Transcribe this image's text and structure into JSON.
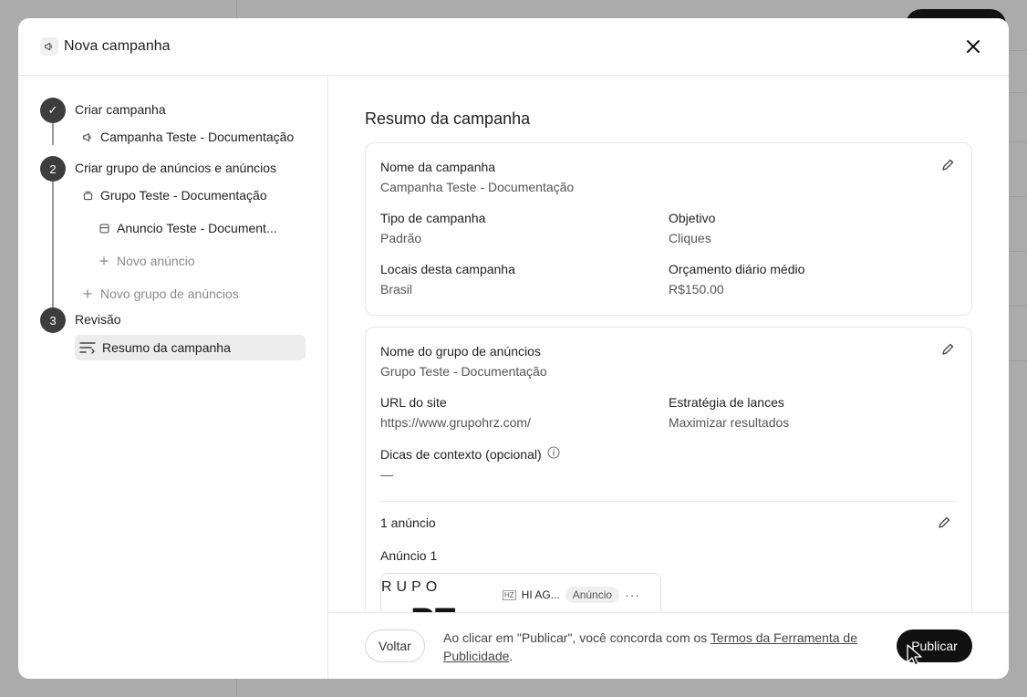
{
  "modal": {
    "title": "Nova campanha"
  },
  "stepper": {
    "step1": {
      "number": "✓",
      "label": "Criar campanha",
      "campaign": "Campanha Teste - Documentação"
    },
    "step2": {
      "number": "2",
      "label": "Criar grupo de anúncios e anúncios",
      "group": "Grupo Teste - Documentação",
      "ad": "Anuncio Teste - Document...",
      "new_ad": "Novo anúncio",
      "new_group": "Novo grupo de anúncios"
    },
    "step3": {
      "number": "3",
      "label": "Revisão",
      "summary": "Resumo da campanha"
    }
  },
  "summary": {
    "title": "Resumo da campanha",
    "campaign_card": {
      "name_label": "Nome da campanha",
      "name_value": "Campanha Teste - Documentação",
      "type_label": "Tipo de campanha",
      "type_value": "Padrão",
      "objective_label": "Objetivo",
      "objective_value": "Cliques",
      "locations_label": "Locais desta campanha",
      "locations_value": "Brasil",
      "budget_label": "Orçamento diário médio",
      "budget_value": "R$150.00"
    },
    "group_card": {
      "name_label": "Nome do grupo de anúncios",
      "name_value": "Grupo Teste - Documentação",
      "url_label": "URL do site",
      "url_value": "https://www.grupohrz.com/",
      "bidding_label": "Estratégia de lances",
      "bidding_value": "Maximizar resultados",
      "context_label": "Dicas de contexto (opcional)",
      "context_value": "—",
      "ads_count": "1 anúncio",
      "ad_title": "Anúncio 1",
      "ad_preview": {
        "logo_text": "RUPO",
        "logo_big": "PE",
        "mark": "HZ",
        "advertiser": "HI AG...",
        "badge": "Anúncio",
        "more": "···"
      }
    }
  },
  "footer": {
    "back": "Voltar",
    "terms_prefix": "Ao clicar em \"Publicar\", você concorda com os ",
    "terms_link": "Termos da Ferramenta de Publicidade",
    "terms_suffix": ".",
    "publish": "Publicar"
  }
}
